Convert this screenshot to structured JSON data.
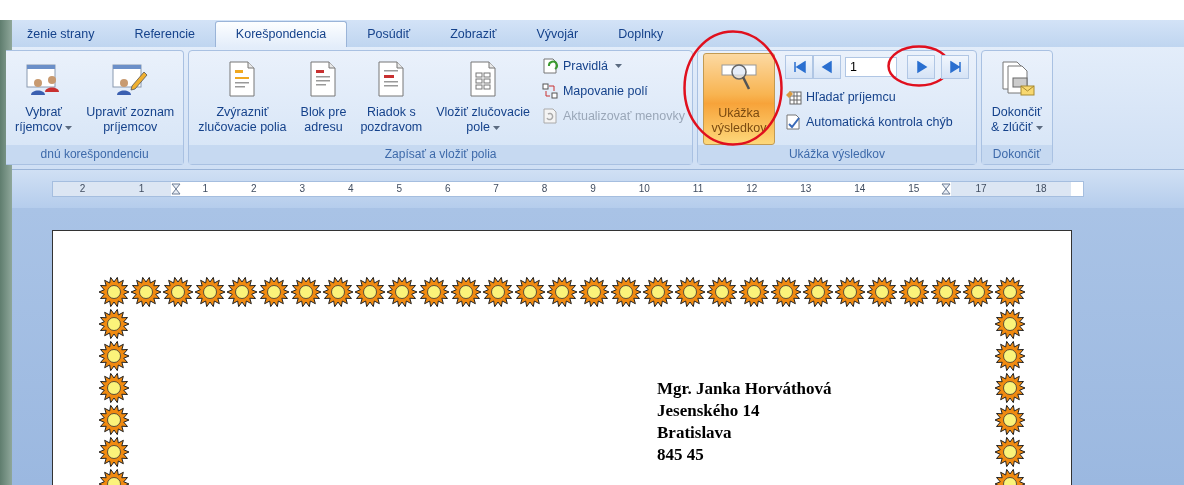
{
  "tabs": [
    {
      "label": "ženie strany",
      "selected": false
    },
    {
      "label": "Referencie",
      "selected": false
    },
    {
      "label": "Korešpondencia",
      "selected": true
    },
    {
      "label": "Posúdiť",
      "selected": false
    },
    {
      "label": "Zobraziť",
      "selected": false
    },
    {
      "label": "Vývojár",
      "selected": false
    },
    {
      "label": "Doplnky",
      "selected": false
    }
  ],
  "groups": [
    {
      "label": "dnú korešpondenciu",
      "items": [
        {
          "kind": "large",
          "lines": [
            "Vybrať",
            "ríjemcov"
          ],
          "dropdown": true
        },
        {
          "kind": "large",
          "lines": [
            "Upraviť zoznam",
            "príjemcov"
          ],
          "dropdown": false
        }
      ]
    },
    {
      "label": "Zapísať a vložiť polia",
      "items": [
        {
          "kind": "large",
          "lines": [
            "Zvýrazniť",
            "zlučovacie polia"
          ],
          "dropdown": false
        },
        {
          "kind": "large",
          "lines": [
            "Blok pre",
            "adresu"
          ],
          "dropdown": false
        },
        {
          "kind": "large",
          "lines": [
            "Riadok s",
            "pozdravom"
          ],
          "dropdown": false
        },
        {
          "kind": "large",
          "lines": [
            "Vložiť zlučovacie",
            "pole"
          ],
          "dropdown": true
        },
        {
          "kind": "stack",
          "buttons": [
            {
              "label": "Pravidlá",
              "dropdown": true,
              "disabled": false
            },
            {
              "label": "Mapovanie polí",
              "dropdown": false,
              "disabled": false
            },
            {
              "label": "Aktualizovať menovky",
              "dropdown": false,
              "disabled": true
            }
          ]
        }
      ]
    },
    {
      "label": "Ukážka výsledkov",
      "items": [
        {
          "kind": "preview",
          "lines": [
            "Ukážka",
            "výsledkov"
          ],
          "selected": true,
          "circled": true
        },
        {
          "kind": "nav",
          "record": "1",
          "buttons": [
            {
              "circled": false
            },
            {
              "circled": false
            },
            {
              "circled": true
            },
            {
              "circled": false
            }
          ],
          "links": [
            {
              "label": "Hľadať príjemcu"
            },
            {
              "label": "Automatická kontrola chýb"
            }
          ]
        }
      ]
    },
    {
      "label": "Dokončiť",
      "items": [
        {
          "kind": "large",
          "lines": [
            "Dokončiť",
            "& zlúčiť"
          ],
          "dropdown": true
        }
      ]
    }
  ],
  "ruler": {
    "before": [
      "2",
      "1"
    ],
    "labels": [
      "1",
      "2",
      "3",
      "4",
      "5",
      "6",
      "7",
      "8",
      "9",
      "10",
      "11",
      "12",
      "13",
      "14",
      "15"
    ],
    "after": [
      "17",
      "18"
    ]
  },
  "address": [
    "Mgr. Janka Horváthová",
    "Jesenského 14",
    "Bratislava",
    "845 45"
  ]
}
